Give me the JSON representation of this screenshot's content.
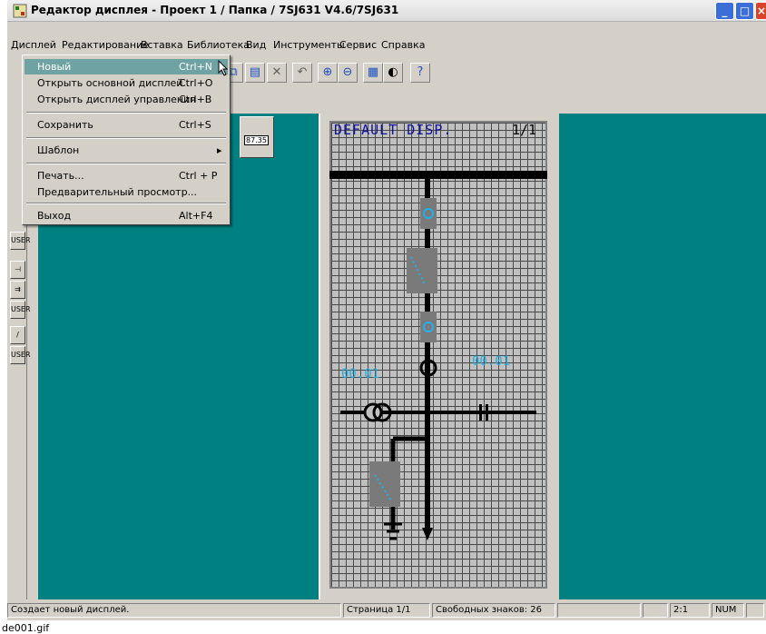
{
  "window": {
    "title": "Редактор дисплея - Проект 1 / Папка / 7SJ631 V4.6/7SJ631"
  },
  "menubar": [
    "Дисплей",
    "Редактирование",
    "Вставка",
    "Библиотека",
    "Вид",
    "Инструменты",
    "Сервис",
    "Справка"
  ],
  "menu_dropdown": {
    "new": {
      "label": "Новый",
      "shortcut": "Ctrl+N"
    },
    "open_main": {
      "label": "Открыть основной дисплей",
      "shortcut": "Ctrl+O"
    },
    "open_control": {
      "label": "Открыть дисплей управления",
      "shortcut": "Ctrl+B"
    },
    "save": {
      "label": "Сохранить",
      "shortcut": "Ctrl+S"
    },
    "template": {
      "label": "Шаблон"
    },
    "print": {
      "label": "Печать...",
      "shortcut": "Ctrl + P"
    },
    "preview": {
      "label": "Предварительный просмотр..."
    },
    "exit": {
      "label": "Выход",
      "shortcut": "Alt+F4"
    }
  },
  "element_value": "87.35",
  "display": {
    "title": "DEFAULT DISP.",
    "page": "1/1",
    "meas_left": "00.01",
    "meas_right": "00.01"
  },
  "statusbar": {
    "message": "Создает новый дисплей.",
    "page": "Страница 1/1",
    "free_chars": "Свободных знаков: 26",
    "zoom": "2:1",
    "num": "NUM"
  },
  "caption": "de001.gif",
  "colors": {
    "workarea": "#008080",
    "grid": "#c0c0c0",
    "highlight": "#6fa3a3",
    "measure": "#1fb0e8"
  }
}
